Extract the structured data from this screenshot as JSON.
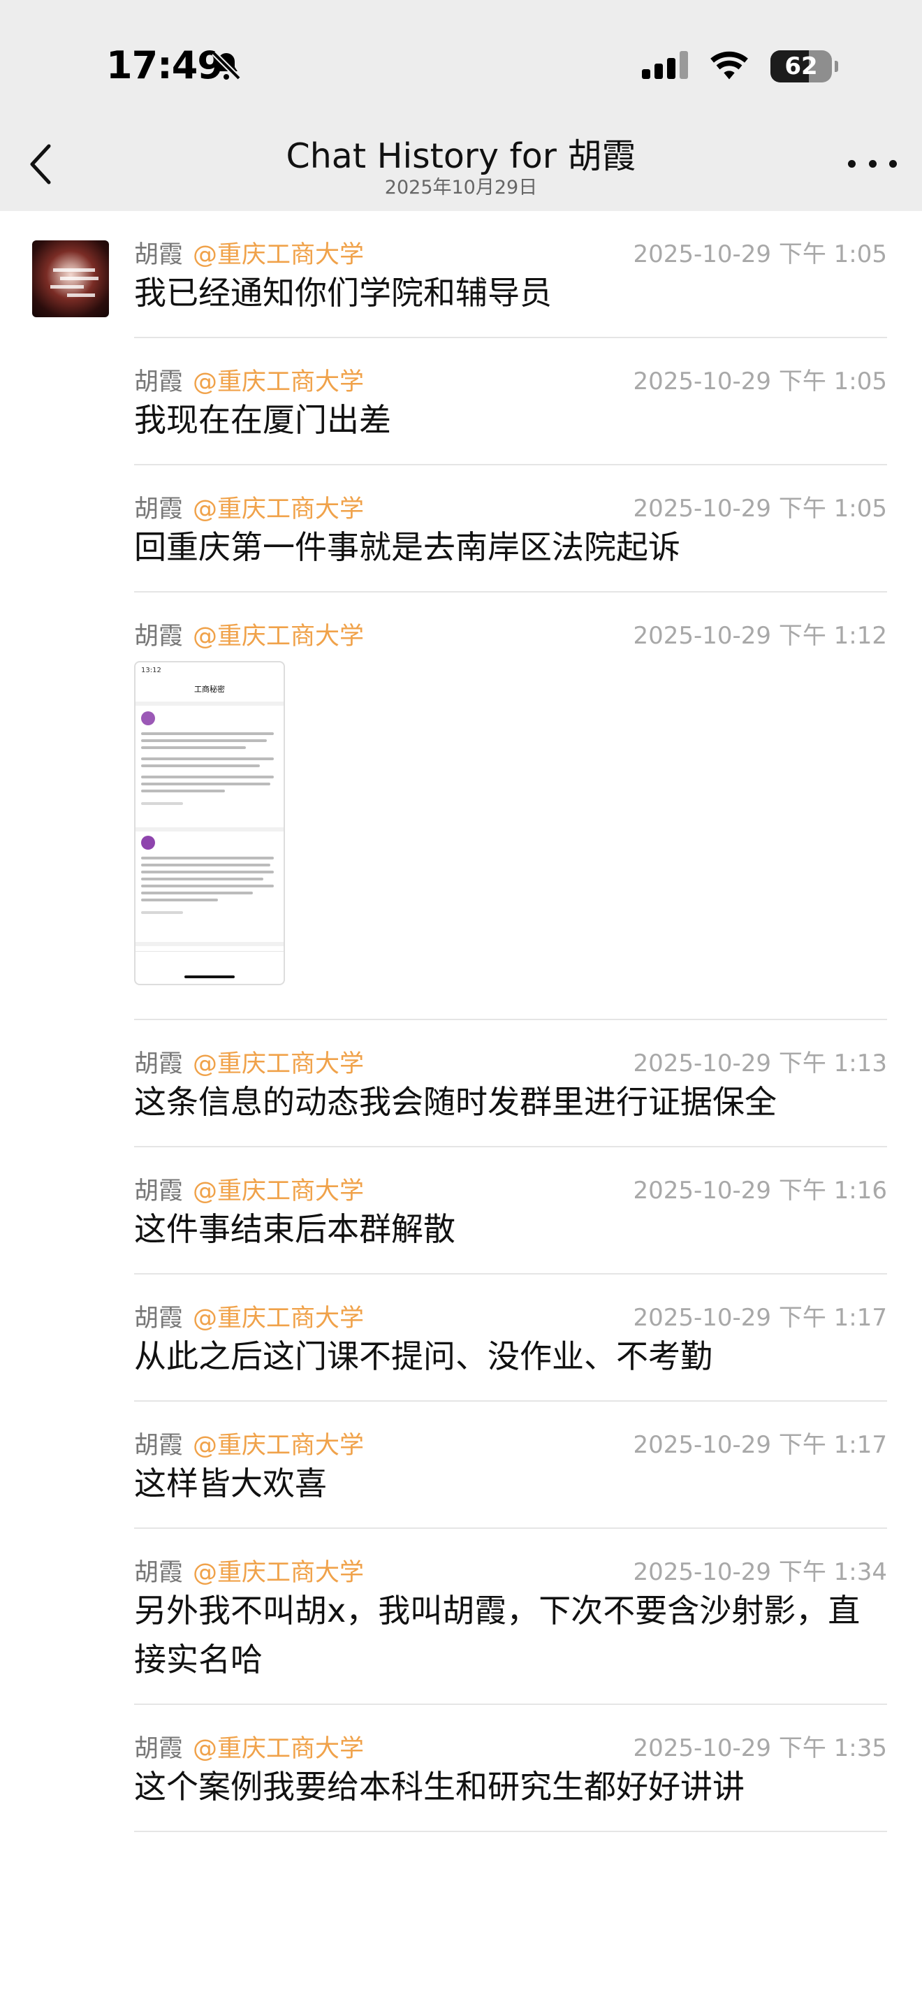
{
  "status": {
    "time": "17:49",
    "battery": "62",
    "battery_level": 0.62
  },
  "nav": {
    "title": "Chat History for 胡霞",
    "subtitle": "2025年10月29日"
  },
  "messages": [
    {
      "sender": "胡霞",
      "org": "@重庆工商大学",
      "time": "2025-10-29 下午 1:05",
      "text": "我已经通知你们学院和辅导员"
    },
    {
      "sender": "胡霞",
      "org": "@重庆工商大学",
      "time": "2025-10-29 下午 1:05",
      "text": "我现在在厦门出差"
    },
    {
      "sender": "胡霞",
      "org": "@重庆工商大学",
      "time": "2025-10-29 下午 1:05",
      "text": "回重庆第一件事就是去南岸区法院起诉"
    },
    {
      "sender": "胡霞",
      "org": "@重庆工商大学",
      "time": "2025-10-29 下午 1:12",
      "text": ""
    },
    {
      "sender": "胡霞",
      "org": "@重庆工商大学",
      "time": "2025-10-29 下午 1:13",
      "text": "这条信息的动态我会随时发群里进行证据保全"
    },
    {
      "sender": "胡霞",
      "org": "@重庆工商大学",
      "time": "2025-10-29 下午 1:16",
      "text": "这件事结束后本群解散"
    },
    {
      "sender": "胡霞",
      "org": "@重庆工商大学",
      "time": "2025-10-29 下午 1:17",
      "text": "从此之后这门课不提问、没作业、不考勤"
    },
    {
      "sender": "胡霞",
      "org": "@重庆工商大学",
      "time": "2025-10-29 下午 1:17",
      "text": "这样皆大欢喜"
    },
    {
      "sender": "胡霞",
      "org": "@重庆工商大学",
      "time": "2025-10-29 下午 1:34",
      "text": "另外我不叫胡x，我叫胡霞，下次不要含沙射影，直接实名哈"
    },
    {
      "sender": "胡霞",
      "org": "@重庆工商大学",
      "time": "2025-10-29 下午 1:35",
      "text": "这个案例我要给本科生和研究生都好好讲讲"
    }
  ],
  "thumbnail": {
    "time": "13:12",
    "title": "工商秘密"
  },
  "colors": {
    "org_accent": "#f0a24a",
    "header_bg": "#ededed",
    "timestamp": "#a8a8a8"
  },
  "icons": [
    "back-chevron-icon",
    "more-dots-icon",
    "mute-bell-icon",
    "signal-icon",
    "wifi-icon",
    "battery-icon"
  ]
}
